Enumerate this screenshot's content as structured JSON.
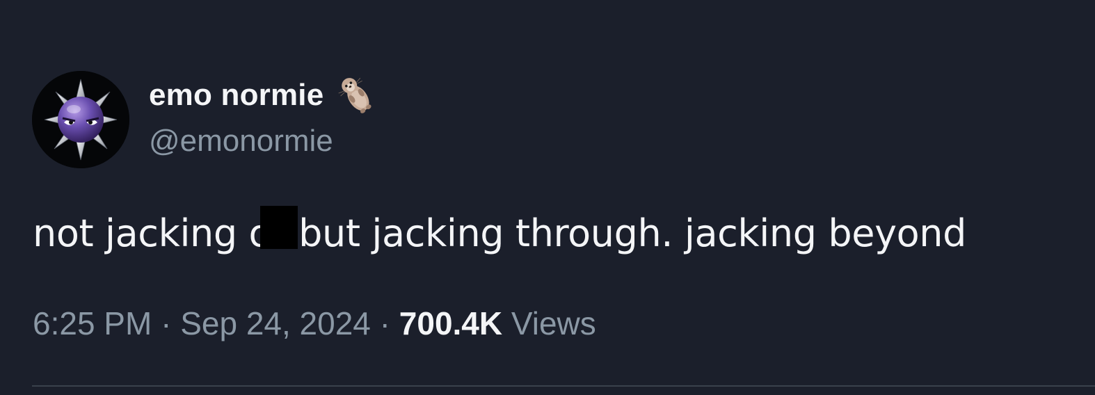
{
  "tweet": {
    "author": {
      "display_name": "emo normie",
      "name_emoji": "otter-icon",
      "handle": "@emonormie",
      "avatar": "spiked-mine-avatar"
    },
    "text_before": "not jacking o",
    "redacted": true,
    "text_after": "but jacking through. jacking beyond",
    "time": "6:25 PM",
    "separator": "·",
    "date": "Sep 24, 2024",
    "views_count": "700.4K",
    "views_label": "Views"
  },
  "colors": {
    "background": "#1b1f2b",
    "primary_text": "#f4f5f7",
    "secondary_text": "#8b98a5",
    "divider": "#3a414c",
    "redaction": "#000000"
  }
}
